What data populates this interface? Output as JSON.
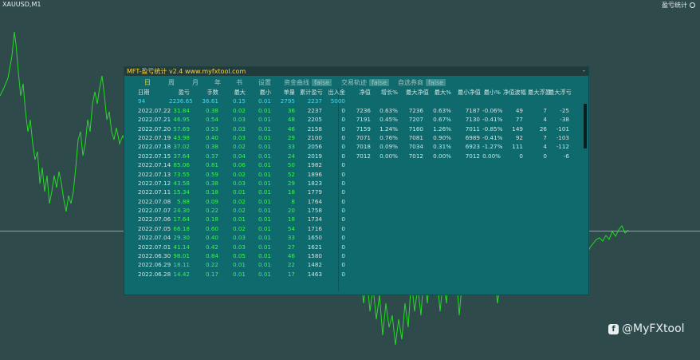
{
  "chart": {
    "symbol_title": "XAUUSD,M1",
    "top_right_label": "盈亏统计",
    "line_color": "#22dd22"
  },
  "panel": {
    "title": "MFT-盈亏统计 v2.4     www.myfxtool.com",
    "close": "-",
    "tabs": [
      "日",
      "周",
      "月",
      "年",
      "书"
    ],
    "settings": "设置",
    "toggles": [
      {
        "label": "资金曲线",
        "value": "false"
      },
      {
        "label": "交易轨迹",
        "value": "false"
      },
      {
        "label": "自选券商",
        "value": "false"
      }
    ],
    "headers": [
      "日期",
      "盈亏",
      "手数",
      "最大",
      "最小",
      "单量",
      "累计盈亏",
      "出入金"
    ],
    "right_headers": [
      "净值",
      "增长%",
      "最大净值",
      "最大%",
      "最小净值",
      "最小%",
      "净值波幅",
      "最大浮盈",
      "最大浮亏"
    ],
    "summary": [
      "94",
      "2236.65",
      "36.61",
      "0.15",
      "0.01",
      "2795",
      "2237",
      "5000"
    ],
    "rows": [
      [
        "2022.07.22",
        "31.84",
        "0.38",
        "0.02",
        "0.01",
        "36",
        "2237",
        "0"
      ],
      [
        "2022.07.21",
        "46.95",
        "0.54",
        "0.03",
        "0.01",
        "48",
        "2205",
        "0"
      ],
      [
        "2022.07.20",
        "57.69",
        "0.53",
        "0.03",
        "0.01",
        "46",
        "2158",
        "0"
      ],
      [
        "2022.07.19",
        "43.98",
        "0.40",
        "0.03",
        "0.01",
        "29",
        "2100",
        "0"
      ],
      [
        "2022.07.18",
        "37.02",
        "0.38",
        "0.02",
        "0.01",
        "33",
        "2056",
        "0"
      ],
      [
        "2022.07.15",
        "37.64",
        "0.37",
        "0.04",
        "0.01",
        "24",
        "2019",
        "0"
      ],
      [
        "2022.07.14",
        "85.06",
        "0.81",
        "0.06",
        "0.01",
        "50",
        "1982",
        "0"
      ],
      [
        "2022.07.13",
        "73.55",
        "0.59",
        "0.02",
        "0.01",
        "52",
        "1896",
        "0"
      ],
      [
        "2022.07.12",
        "43.58",
        "0.38",
        "0.03",
        "0.01",
        "29",
        "1823",
        "0"
      ],
      [
        "2022.07.11",
        "15.34",
        "0.18",
        "0.01",
        "0.01",
        "18",
        "1779",
        "0"
      ],
      [
        "2022.07.08",
        "5.88",
        "0.09",
        "0.02",
        "0.01",
        "8",
        "1764",
        "0"
      ],
      [
        "2022.07.07",
        "24.30",
        "0.22",
        "0.02",
        "0.01",
        "20",
        "1758",
        "0"
      ],
      [
        "2022.07.06",
        "17.64",
        "0.18",
        "0.01",
        "0.01",
        "18",
        "1734",
        "0"
      ],
      [
        "2022.07.05",
        "66.18",
        "0.60",
        "0.02",
        "0.01",
        "54",
        "1716",
        "0"
      ],
      [
        "2022.07.04",
        "29.30",
        "0.40",
        "0.03",
        "0.01",
        "33",
        "1650",
        "0"
      ],
      [
        "2022.07.01",
        "41.14",
        "0.42",
        "0.03",
        "0.01",
        "27",
        "1621",
        "0"
      ],
      [
        "2022.06.30",
        "98.01",
        "0.84",
        "0.05",
        "0.01",
        "46",
        "1580",
        "0"
      ],
      [
        "2022.06.29",
        "18.11",
        "0.22",
        "0.01",
        "0.01",
        "22",
        "1482",
        "0"
      ],
      [
        "2022.06.28",
        "14.42",
        "0.17",
        "0.01",
        "0.01",
        "17",
        "1463",
        "0"
      ]
    ],
    "stats": [
      [
        "7236",
        "0.63%",
        "7236",
        "0.63%",
        "7187",
        "-0.06%",
        "49",
        "7",
        "-25"
      ],
      [
        "7191",
        "0.45%",
        "7207",
        "0.67%",
        "7130",
        "-0.41%",
        "77",
        "4",
        "-38"
      ],
      [
        "7159",
        "1.24%",
        "7160",
        "1.26%",
        "7011",
        "-0.85%",
        "149",
        "26",
        "-101"
      ],
      [
        "7071",
        "0.76%",
        "7081",
        "0.90%",
        "6989",
        "-0.41%",
        "92",
        "7",
        "-103"
      ],
      [
        "7018",
        "0.09%",
        "7034",
        "0.31%",
        "6923",
        "-1.27%",
        "111",
        "4",
        "-112"
      ],
      [
        "7012",
        "0.00%",
        "7012",
        "0.00%",
        "7012",
        "0.00%",
        "0",
        "0",
        "-6"
      ]
    ]
  },
  "watermark": "@MyFXtool"
}
